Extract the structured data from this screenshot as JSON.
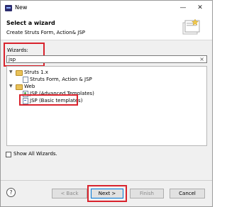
{
  "window": {
    "title": "New"
  },
  "header": {
    "title": "Select a wizard",
    "description": "Create Struts Form, Action& JSP"
  },
  "wizards": {
    "label": "Wizards:",
    "filter_value": "jsp",
    "clear_glyph": "×",
    "tree": [
      {
        "label": "Struts 1.x",
        "expanded": true,
        "icon": "folder-icon"
      },
      {
        "label": "Struts Form, Action & JSP",
        "icon": "struts-file-icon"
      },
      {
        "label": "Web",
        "expanded": true,
        "icon": "folder-icon"
      },
      {
        "label": "JSP (Advanced Templates)",
        "icon": "jsp-file-icon"
      },
      {
        "label": "JSP (Basic templates)",
        "icon": "jsp-file-icon",
        "selected": true
      }
    ]
  },
  "show_all": {
    "label": "Show All Wizards.",
    "checked": false
  },
  "buttons": {
    "help": "?",
    "back": "< Back",
    "next": "Next >",
    "finish": "Finish",
    "cancel": "Cancel"
  },
  "colors": {
    "highlight": "#d9232d",
    "dialog_bg": "#f0f0f0"
  }
}
